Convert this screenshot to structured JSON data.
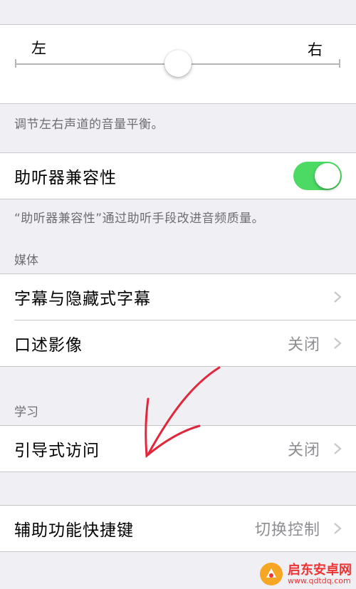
{
  "slider": {
    "left_label": "左",
    "right_label": "右",
    "balance": 0.5
  },
  "slider_footer": "调节左右声道的音量平衡。",
  "hearing_aid": {
    "label": "助听器兼容性",
    "enabled": true
  },
  "hearing_aid_footer": "“助听器兼容性”通过助听手段改进音频质量。",
  "media": {
    "header": "媒体",
    "items": [
      {
        "label": "字幕与隐藏式字幕",
        "value": ""
      },
      {
        "label": "口述影像",
        "value": "关闭"
      }
    ]
  },
  "learning": {
    "header": "学习",
    "items": [
      {
        "label": "引导式访问",
        "value": "关闭"
      }
    ]
  },
  "shortcut": {
    "label": "辅助功能快捷键",
    "value": "切换控制"
  },
  "watermark": {
    "title": "启东安卓网",
    "url": "www.qdtdq.com"
  },
  "colors": {
    "toggle_on": "#4cd964",
    "annotation_arrow": "#e0283c"
  }
}
